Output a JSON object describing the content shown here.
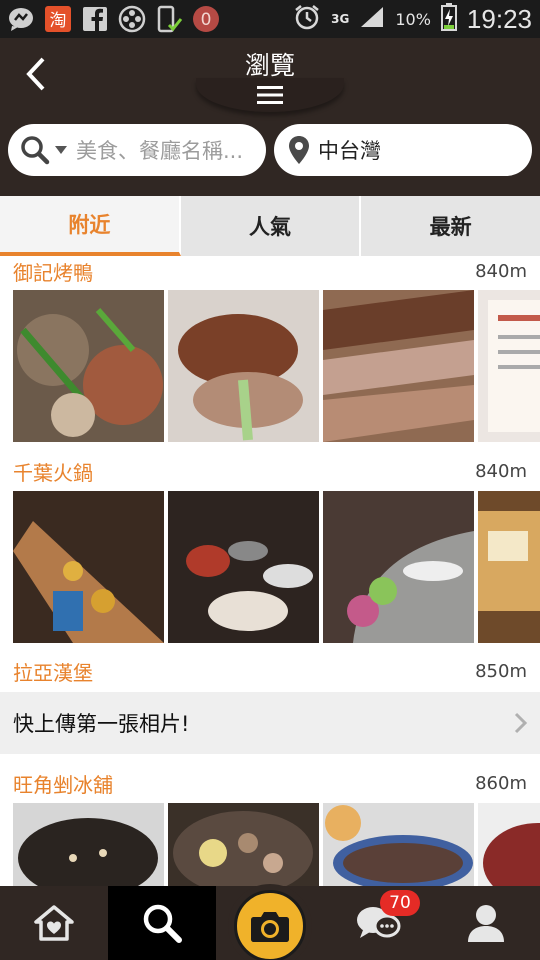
{
  "status_bar": {
    "notification_icons": [
      "message-icon",
      "taobao-icon",
      "facebook-icon",
      "film-reel-icon",
      "phone-check-icon",
      "zero-circle-icon"
    ],
    "network": "3G",
    "battery": "10%",
    "time": "19:23"
  },
  "header": {
    "title": "瀏覽",
    "search_placeholder": "美食、餐廳名稱...",
    "location": "中台灣"
  },
  "tabs": [
    {
      "label": "附近",
      "active": true
    },
    {
      "label": "人氣",
      "active": false
    },
    {
      "label": "最新",
      "active": false
    }
  ],
  "restaurants": [
    {
      "name": "御記烤鴨",
      "distance": "840m"
    },
    {
      "name": "千葉火鍋",
      "distance": "840m"
    },
    {
      "name": "拉亞漢堡",
      "distance": "850m",
      "upload_prompt": "快上傳第一張相片!"
    },
    {
      "name": "旺角剉冰舖",
      "distance": "860m"
    }
  ],
  "bottom_nav": {
    "items": [
      "home-icon",
      "search-icon",
      "camera-icon",
      "chat-icon",
      "profile-icon"
    ],
    "chat_badge": "70"
  },
  "colors": {
    "accent": "#e8832d",
    "header_bg": "#302723",
    "camera": "#f0b22a",
    "badge": "#e52b26"
  }
}
